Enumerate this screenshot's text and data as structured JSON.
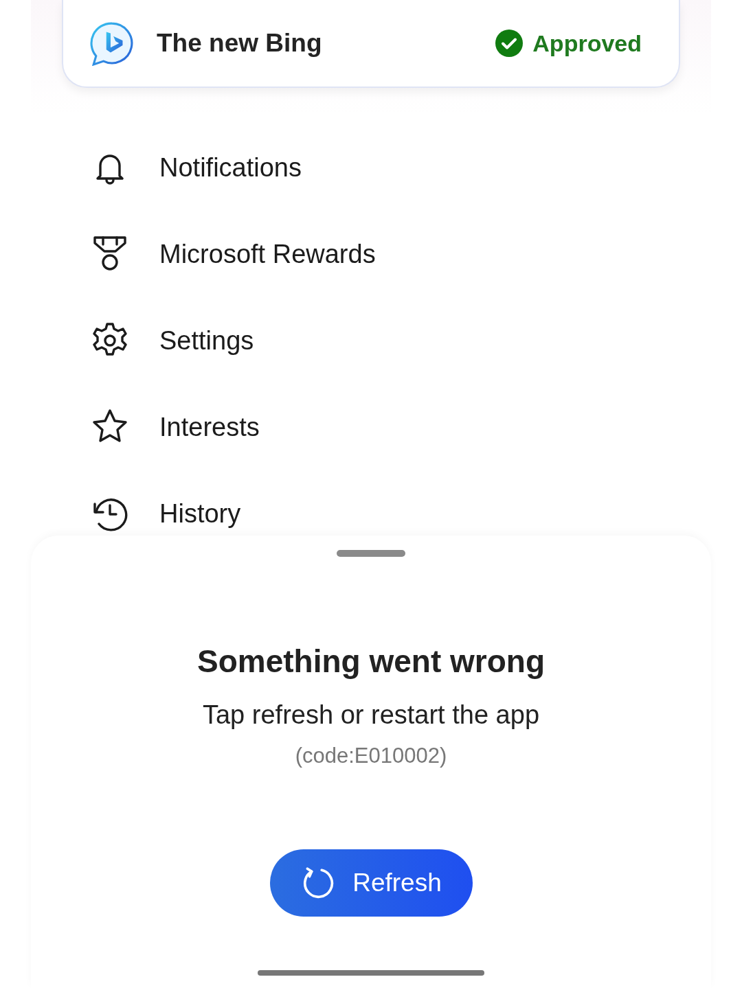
{
  "app_card": {
    "name": "The new Bing",
    "status": "Approved"
  },
  "menu": [
    {
      "label": "Notifications",
      "kind": "bell"
    },
    {
      "label": "Microsoft Rewards",
      "kind": "medal"
    },
    {
      "label": "Settings",
      "kind": "gear"
    },
    {
      "label": "Interests",
      "kind": "star"
    },
    {
      "label": "History",
      "kind": "history"
    }
  ],
  "error_sheet": {
    "title": "Something went wrong",
    "message": "Tap refresh or restart the app",
    "code": "(code:E010002)",
    "button": "Refresh"
  }
}
